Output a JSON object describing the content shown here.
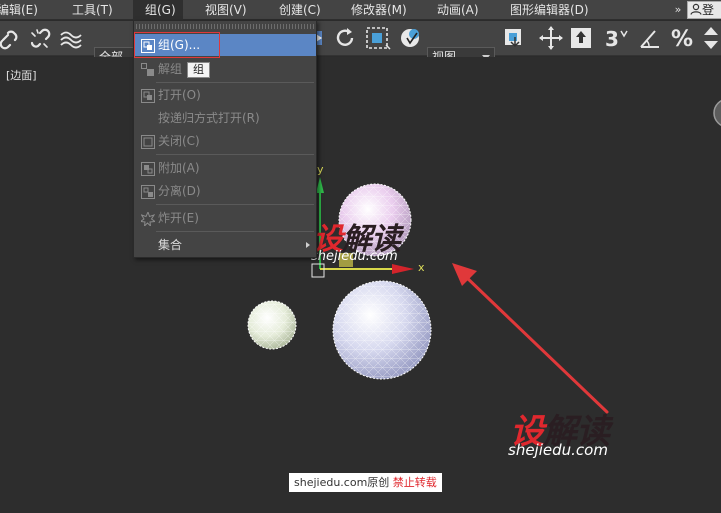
{
  "menubar": {
    "items": [
      {
        "label": "编辑(E)"
      },
      {
        "label": "工具(T)"
      },
      {
        "label": "组(G)"
      },
      {
        "label": "视图(V)"
      },
      {
        "label": "创建(C)"
      },
      {
        "label": "修改器(M)"
      },
      {
        "label": "动画(A)"
      },
      {
        "label": "图形编辑器(D)"
      }
    ],
    "more": "»",
    "user_label": "登"
  },
  "toolbar": {
    "selection_scope": "全部",
    "reference_coord": "视图"
  },
  "group_menu": {
    "items": [
      {
        "label": "组(G)...",
        "icon": "group-icon",
        "state": "highlighted"
      },
      {
        "label": "解组",
        "icon": "ungroup-icon",
        "state": "disabled"
      },
      {
        "label": "打开(O)",
        "icon": "open-group-icon",
        "state": "disabled"
      },
      {
        "label": "按递归方式打开(R)",
        "icon": "",
        "state": "disabled"
      },
      {
        "label": "关闭(C)",
        "icon": "close-group-icon",
        "state": "disabled"
      },
      {
        "label": "附加(A)",
        "icon": "attach-icon",
        "state": "disabled"
      },
      {
        "label": "分离(D)",
        "icon": "detach-icon",
        "state": "disabled"
      },
      {
        "label": "炸开(E)",
        "icon": "explode-icon",
        "state": "disabled"
      },
      {
        "label": "集合",
        "icon": "",
        "state": "submenu"
      }
    ],
    "tooltip": "组"
  },
  "viewport": {
    "label": "[边面]",
    "axis_x": "x",
    "axis_y": "y"
  },
  "watermark": {
    "logo_red": "设",
    "logo_dark": "解读",
    "url": "shejiedu.com",
    "credit_site": "shejiedu.com原创",
    "credit_warning": "禁止转载"
  },
  "colors": {
    "menu_highlight": "#5b86c5",
    "annotation_red": "#e0383a",
    "watermark_red": "#e0282e",
    "ui_panel": "#444444",
    "viewport_bg": "#2d2d2d"
  }
}
